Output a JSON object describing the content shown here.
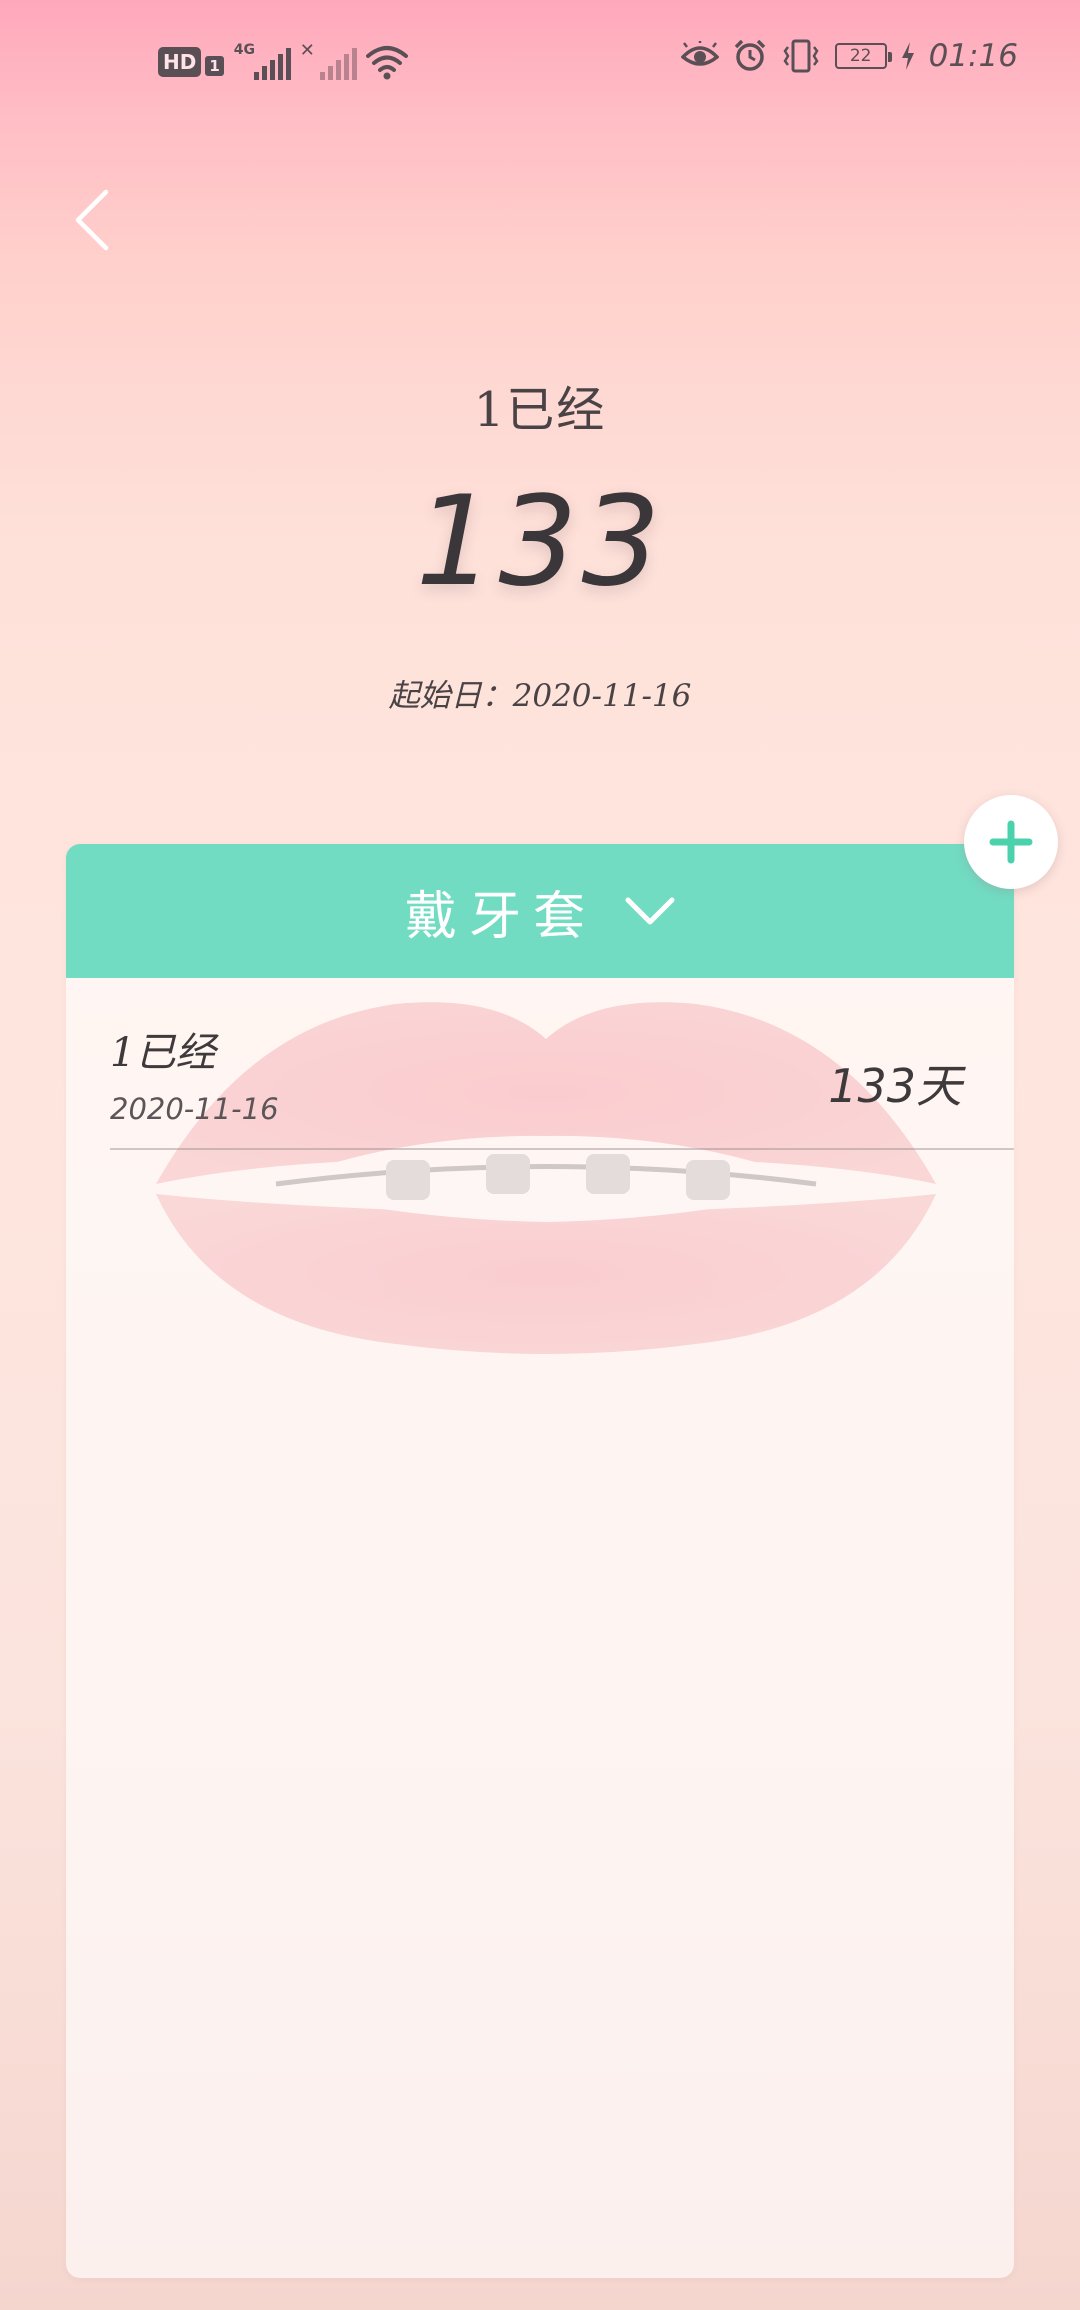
{
  "status_bar": {
    "hd_label": "HD",
    "hd_sub": "1",
    "network_label": "4G",
    "battery_level": "22",
    "time": "01:16",
    "icons": [
      "hd-icon",
      "signal-4g-icon",
      "signal-no-service-icon",
      "wifi-icon",
      "eye-comfort-icon",
      "alarm-icon",
      "vibrate-icon",
      "battery-icon",
      "charging-icon"
    ]
  },
  "header": {
    "back_icon": "chevron-left-icon"
  },
  "hero": {
    "label": "1已经",
    "count": "133",
    "start_date": "起始日：2020-11-16"
  },
  "card": {
    "header_title": "戴牙套",
    "header_icon": "chevron-down-icon",
    "accent_color": "#72dcc3",
    "records": [
      {
        "title": "1已经",
        "date": "2020-11-16",
        "days": "133天"
      }
    ]
  },
  "add_button": {
    "icon": "plus-icon",
    "color": "#4cd1ad"
  }
}
